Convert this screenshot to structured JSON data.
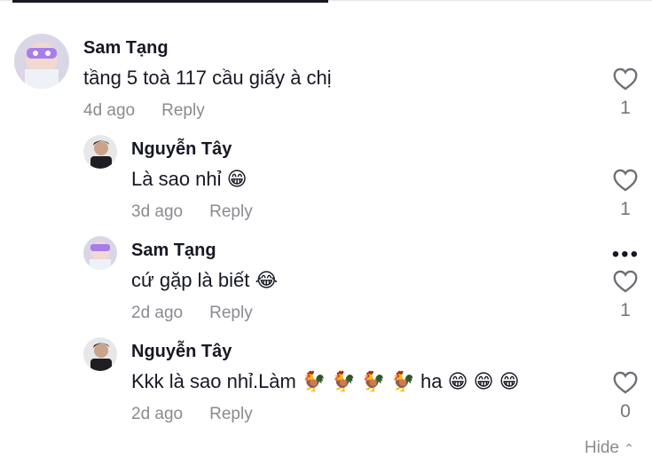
{
  "comments": [
    {
      "username": "Sam Tạng",
      "text": "tầng 5 toà 117 cầu giấy à chị",
      "time": "4d ago",
      "reply": "Reply",
      "likes": "1"
    },
    {
      "username": "Nguyễn Tây",
      "text": "Là sao nhỉ 😁",
      "time": "3d ago",
      "reply": "Reply",
      "likes": "1"
    },
    {
      "username": "Sam Tạng",
      "text": "cứ gặp là biết 😂",
      "time": "2d ago",
      "reply": "Reply",
      "likes": "1"
    },
    {
      "username": "Nguyễn Tây",
      "text": "Kkk là sao nhỉ.Làm 🐓 🐓 🐓 🐓 ha 😁 😁 😁",
      "time": "2d ago",
      "reply": "Reply",
      "likes": "0"
    }
  ],
  "hide_label": "Hide",
  "icons": {
    "like": "heart-outline-icon",
    "more": "more-options-icon",
    "hide": "chevron-up-icon"
  }
}
